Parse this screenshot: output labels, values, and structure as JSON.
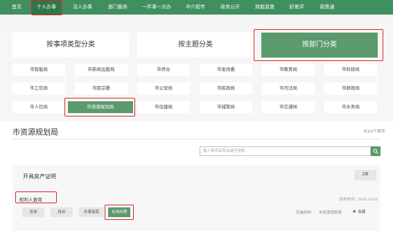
{
  "nav": {
    "items": [
      {
        "label": "首页"
      },
      {
        "label": "个人办事"
      },
      {
        "label": "法人办事"
      },
      {
        "label": "部门服务"
      },
      {
        "label": "一件事一次办"
      },
      {
        "label": "中介超市"
      },
      {
        "label": "政务公开"
      },
      {
        "label": "效能监督"
      },
      {
        "label": "好差评"
      },
      {
        "label": "政策通"
      }
    ],
    "active_index": 1
  },
  "category_tabs": [
    {
      "label": "按事项类型分类"
    },
    {
      "label": "按主题分类"
    },
    {
      "label": "按部门分类"
    }
  ],
  "departments": [
    "市智能局",
    "市新闻出版局",
    "市侨办",
    "市发改委",
    "市教育局",
    "市科技局",
    "市工信局",
    "市民宗委",
    "市公安局",
    "市民政局",
    "市司法局",
    "市财政局",
    "市人社局",
    "市资源规划局",
    "市住建局",
    "市城管局",
    "市交通局",
    "市水务局"
  ],
  "section": {
    "title": "市资源规划局",
    "count": "共114个事项"
  },
  "search": {
    "placeholder": "输入事项名称关键字搜索"
  },
  "card": {
    "title": "开具房产证明",
    "button": "3项",
    "item_title": "权利人查询",
    "date": "发布时间：2021-12-01",
    "actions": [
      "咨询",
      "投诉",
      "办事指南",
      "在线办理"
    ],
    "agency": "实施机构",
    "agency_value": "市资源规划局",
    "favorite": "收藏"
  },
  "colors": {
    "nav_bg": "#3f8f5f",
    "accent": "#5a9a6d",
    "highlight": "#d9262c"
  }
}
